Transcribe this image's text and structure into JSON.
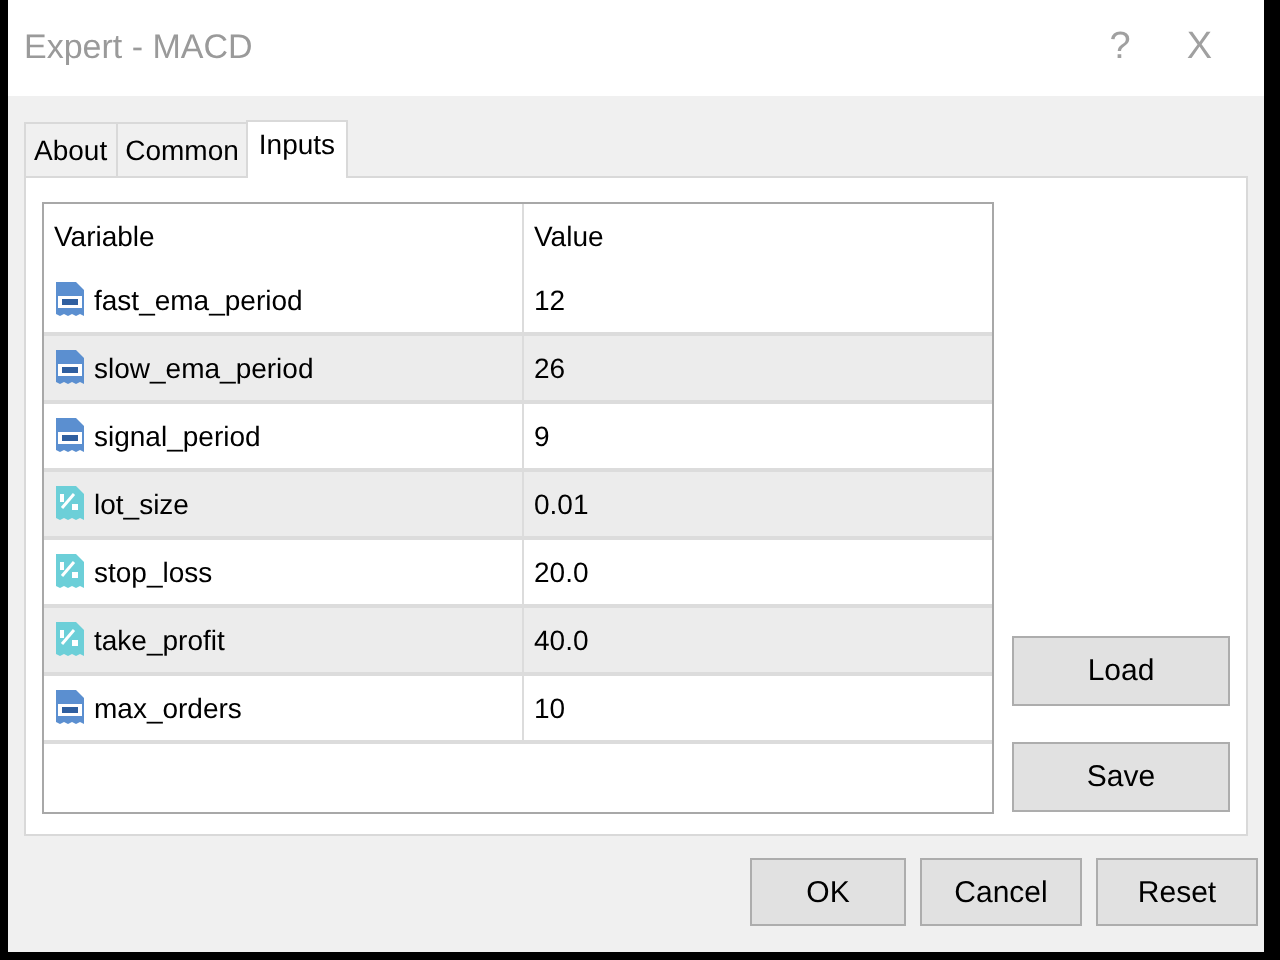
{
  "window": {
    "title": "Expert - MACD",
    "help": "?",
    "close": "X"
  },
  "tabs": [
    {
      "label": "About",
      "selected": false
    },
    {
      "label": "Common",
      "selected": false
    },
    {
      "label": "Inputs",
      "selected": true
    }
  ],
  "table": {
    "columns": [
      "Variable",
      "Value"
    ],
    "rows": [
      {
        "kind": "int",
        "variable": "fast_ema_period",
        "value": "12"
      },
      {
        "kind": "int",
        "variable": "slow_ema_period",
        "value": "26"
      },
      {
        "kind": "int",
        "variable": "signal_period",
        "value": "9"
      },
      {
        "kind": "double",
        "variable": "lot_size",
        "value": "0.01"
      },
      {
        "kind": "double",
        "variable": "stop_loss",
        "value": "20.0"
      },
      {
        "kind": "double",
        "variable": "take_profit",
        "value": "40.0"
      },
      {
        "kind": "int",
        "variable": "max_orders",
        "value": "10"
      }
    ]
  },
  "side_buttons": [
    "Load",
    "Save"
  ],
  "buttons": [
    "OK",
    "Cancel",
    "Reset"
  ]
}
